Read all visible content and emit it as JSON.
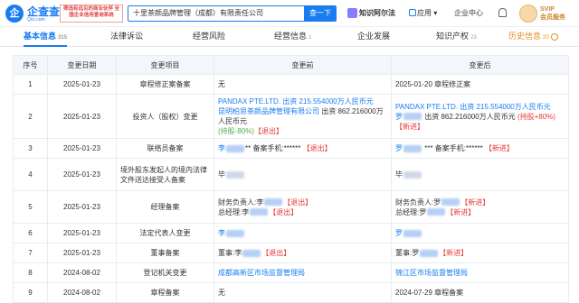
{
  "header": {
    "logo_char": "企",
    "brand": "企查查",
    "brand_sub": "Qcc.com",
    "slogan": "筛选有远见的商业伙伴 全国企业信用查询系统",
    "search_value": "十里茶颜品牌管理（成都）有限责任公司",
    "search_button": "查一下",
    "ai_label": "知识阿尔法",
    "apps_label": "应用",
    "center_label": "企业中心",
    "svip_label": "SVIP\n会员服务"
  },
  "tabs": [
    {
      "label": "基本信息",
      "count": "315",
      "active": true
    },
    {
      "label": "法律诉讼",
      "count": ""
    },
    {
      "label": "经营风险",
      "count": ""
    },
    {
      "label": "经营信息",
      "count": "1"
    },
    {
      "label": "企业发展",
      "count": ""
    },
    {
      "label": "知识产权",
      "count": "23"
    },
    {
      "label": "历史信息",
      "count": "20",
      "hist": true
    }
  ],
  "table": {
    "headers": [
      "序号",
      "变更日期",
      "变更项目",
      "变更前",
      "变更后"
    ],
    "rows": [
      {
        "no": "1",
        "date": "2025-01-23",
        "item": "章程修正案备案",
        "before": "无",
        "after": "2025-01-20 章程修正案"
      },
      {
        "no": "2",
        "date": "2025-01-23",
        "item": "投资人（股权）变更",
        "before_l1": "PANDAX PTE.LTD. 出资 215.554000万人民币元",
        "before_l2a": "昆明柏思茶颜品牌管理有限公司",
        "before_l2b": " 出资 862.216000万人民币元",
        "before_l3a": "(持股-80%)",
        "before_l3b": "【退出】",
        "after_l1": "PANDAX PTE.LTD. 出资 215.554000万人民币元",
        "after_l2a": "罗",
        "after_l2b": " 出资 862.216000万人民币元 ",
        "after_l2c": "(持股+80%)",
        "after_l2d": "【新进】"
      },
      {
        "no": "3",
        "date": "2025-01-23",
        "item": "联络员备案",
        "before_a": "李",
        "before_b": "** 备案手机:****** ",
        "before_c": "【退出】",
        "after_a": "罗",
        "after_b": " *** 备案手机:****** ",
        "after_c": "【新进】"
      },
      {
        "no": "4",
        "date": "2025-01-23",
        "item": "境外股东发起人的境内法律文件送达接受人备案",
        "before": "毕",
        "after": "毕"
      },
      {
        "no": "5",
        "date": "2025-01-23",
        "item": "经理备案",
        "before_l1a": "财务负责人:李",
        "before_l1b": "【退出】",
        "before_l2a": "总经理:李",
        "before_l2b": "【退出】",
        "after_l1a": "财务负责人:罗",
        "after_l1b": "【新进】",
        "after_l2a": "总经理:罗",
        "after_l2b": "【新进】"
      },
      {
        "no": "6",
        "date": "2025-01-23",
        "item": "法定代表人变更",
        "before": "李",
        "after": "罗"
      },
      {
        "no": "7",
        "date": "2025-01-23",
        "item": "董事备案",
        "before_a": "董事:李",
        "before_c": "【退出】",
        "after_a": "董事:罗",
        "after_c": "【新进】"
      },
      {
        "no": "8",
        "date": "2024-08-02",
        "item": "登记机关变更",
        "before": "成都高新区市场监督管理局",
        "after": "锦江区市场监督管理局"
      },
      {
        "no": "9",
        "date": "2024-08-02",
        "item": "章程备案",
        "before": "无",
        "after": "2024-07-29 章程备案"
      }
    ]
  }
}
